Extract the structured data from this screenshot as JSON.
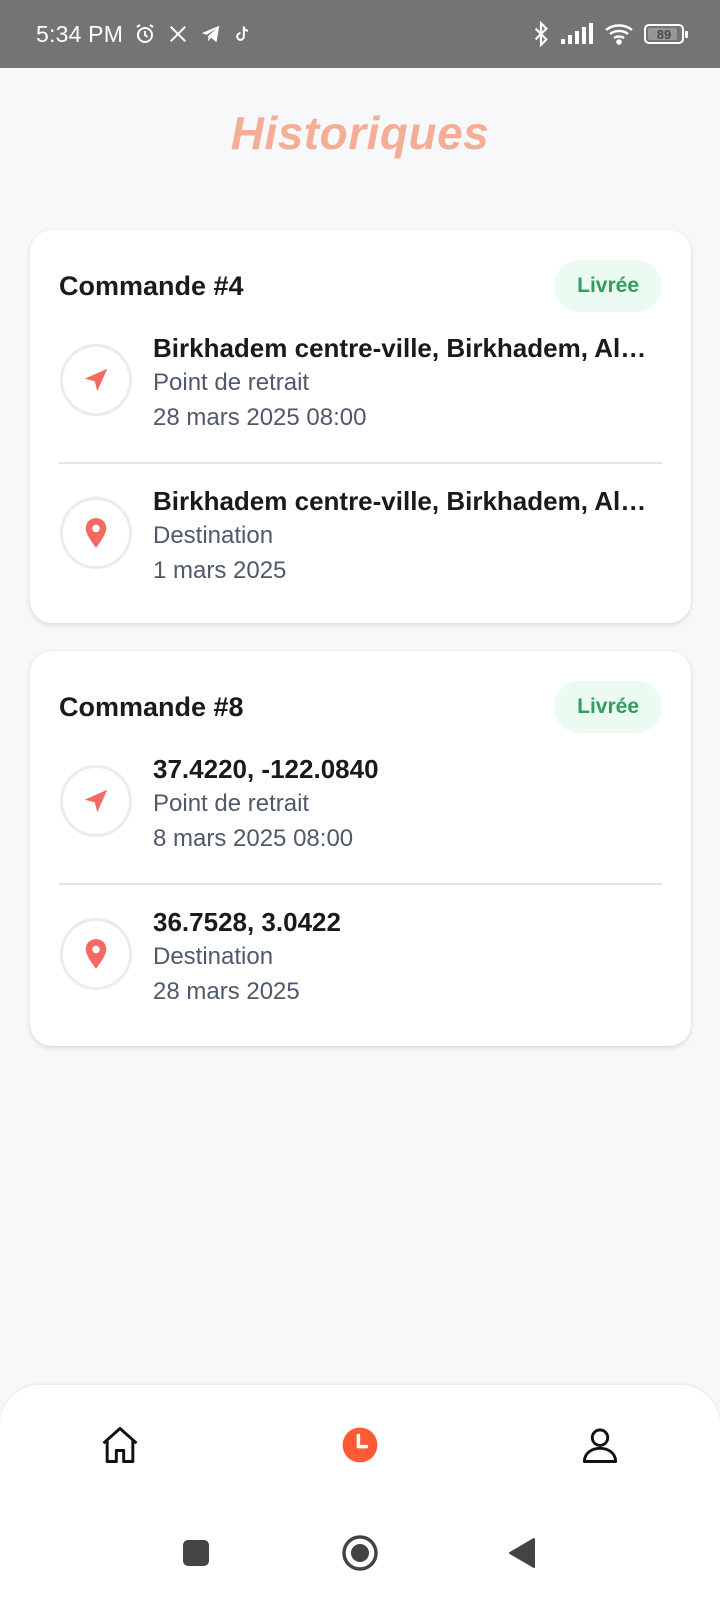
{
  "status_bar": {
    "time": "5:34 PM",
    "left_icons": [
      "alarm-icon",
      "x-icon",
      "telegram-icon",
      "tiktok-icon"
    ],
    "right_icons": [
      "bluetooth-icon",
      "signal-icon",
      "wifi-icon"
    ],
    "battery": "89"
  },
  "header": {
    "title": "Historiques"
  },
  "orders": [
    {
      "title": "Commande #4",
      "status": "Livrée",
      "pickup": {
        "address": "Birkhadem centre-ville, Birkhadem, Algérie",
        "kind": "Point de retrait",
        "date": "28 mars 2025 08:00"
      },
      "destination": {
        "address": "Birkhadem centre-ville, Birkhadem, Algérie",
        "kind": "Destination",
        "date": "1 mars 2025"
      }
    },
    {
      "title": "Commande #8",
      "status": "Livrée",
      "pickup": {
        "address": "37.4220, -122.0840",
        "kind": "Point de retrait",
        "date": "8 mars 2025 08:00"
      },
      "destination": {
        "address": "36.7528, 3.0422",
        "kind": "Destination",
        "date": "28 mars 2025"
      }
    }
  ],
  "bottom_nav": {
    "items": [
      {
        "icon": "home-icon",
        "active": false
      },
      {
        "icon": "clock-icon",
        "active": true
      },
      {
        "icon": "user-icon",
        "active": false
      }
    ]
  },
  "colors": {
    "accent": "#ff5a36",
    "title": "#f4ae98",
    "pin": "#f26b62",
    "badge_bg": "#ecfbf1",
    "badge_text": "#2f9e5e"
  }
}
